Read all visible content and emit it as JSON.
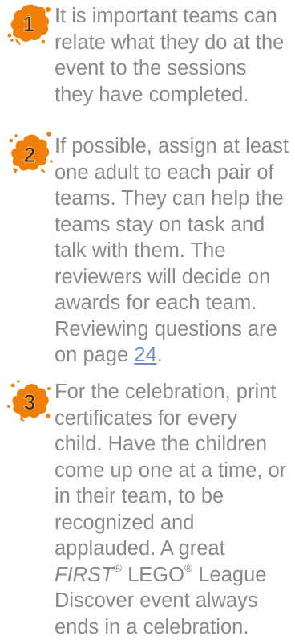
{
  "colors": {
    "text": "#8a8a8a",
    "badge_orange": "#f07f0a",
    "badge_shadow": "#d66c05",
    "number_dark": "#3b2a14",
    "link": "#6f8ec7"
  },
  "tips": [
    {
      "number": "1",
      "icon": "splat-number-1-icon",
      "text": "It is important teams can relate what they do at the event to the sessions they have completed."
    },
    {
      "number": "2",
      "icon": "splat-number-2-icon",
      "text_before_link": "If possible, assign at least one adult to each pair of teams. They can help the teams stay on task and talk with them. The reviewers will decide on awards for each team. Reviewing questions are on page ",
      "link_text": "24",
      "text_after_link": "."
    },
    {
      "number": "3",
      "icon": "splat-number-3-icon",
      "text_part1": "For the celebration, print certificates for every child. Have the children come up one at a time, or in their team, to be recognized and applauded. A great ",
      "first_word": "FIRST",
      "reg_mark_1": "®",
      "lego_word": " LEGO",
      "reg_mark_2": "®",
      "text_part2": " League Discover event always ends in a celebration."
    }
  ]
}
